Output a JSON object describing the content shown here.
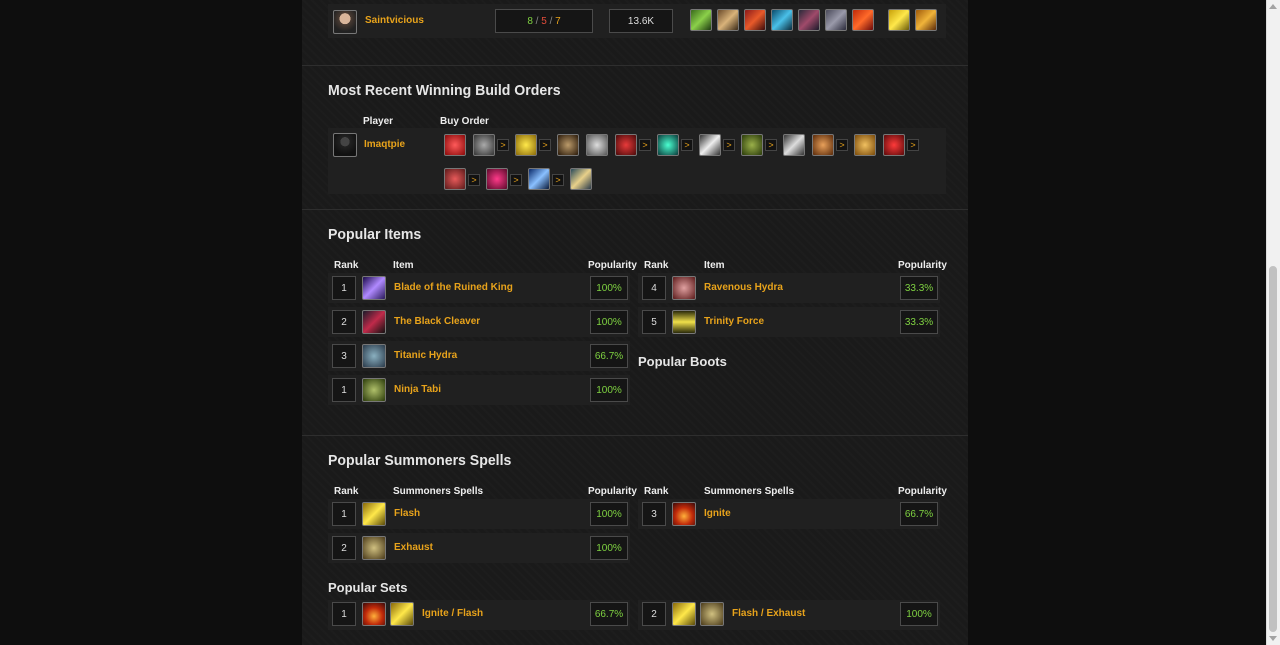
{
  "top_row": {
    "player": "Saintvicious",
    "kda": {
      "k": "8",
      "d": "5",
      "a": "7",
      "sep": "/"
    },
    "gold": "13.6K"
  },
  "recent_builds": {
    "title": "Most Recent Winning Build Orders",
    "col_player": "Player",
    "col_buy_order": "Buy Order",
    "player": "Imaqtpie",
    "separator": ">"
  },
  "popular_items": {
    "title": "Popular Items",
    "col_rank": "Rank",
    "col_item": "Item",
    "col_popularity": "Popularity",
    "left": [
      {
        "rank": "1",
        "name": "Blade of the Ruined King",
        "popularity": "100%",
        "icon": "blade-ruined-king-icon"
      },
      {
        "rank": "2",
        "name": "The Black Cleaver",
        "popularity": "100%",
        "icon": "black-cleaver-icon"
      },
      {
        "rank": "3",
        "name": "Titanic Hydra",
        "popularity": "66.7%",
        "icon": "titanic-hydra-icon"
      }
    ],
    "right": [
      {
        "rank": "4",
        "name": "Ravenous Hydra",
        "popularity": "33.3%",
        "icon": "ravenous-hydra-icon"
      },
      {
        "rank": "5",
        "name": "Trinity Force",
        "popularity": "33.3%",
        "icon": "trinity-force-icon"
      }
    ],
    "boots_title": "Popular Boots",
    "boots": [
      {
        "rank": "1",
        "name": "Ninja Tabi",
        "popularity": "100%",
        "icon": "ninja-tabi-icon"
      }
    ]
  },
  "summoner_spells": {
    "title": "Popular Summoners Spells",
    "col_rank": "Rank",
    "col_spell": "Summoners Spells",
    "col_popularity": "Popularity",
    "left": [
      {
        "rank": "1",
        "name": "Flash",
        "popularity": "100%",
        "icon": "flash-icon"
      },
      {
        "rank": "2",
        "name": "Exhaust",
        "popularity": "100%",
        "icon": "exhaust-icon"
      }
    ],
    "right": [
      {
        "rank": "3",
        "name": "Ignite",
        "popularity": "66.7%",
        "icon": "ignite-icon"
      }
    ]
  },
  "popular_sets": {
    "title": "Popular Sets",
    "items": [
      {
        "rank": "1",
        "name": "Ignite / Flash",
        "popularity": "66.7%"
      },
      {
        "rank": "2",
        "name": "Flash / Exhaust",
        "popularity": "100%"
      }
    ]
  }
}
